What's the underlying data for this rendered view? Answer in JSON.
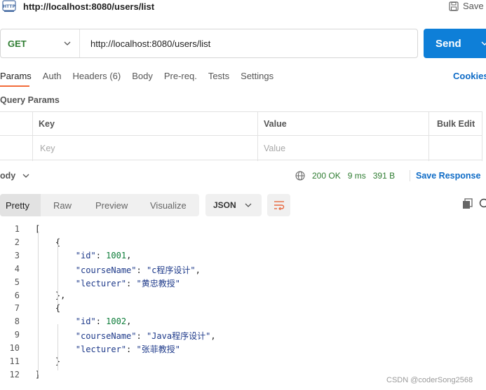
{
  "header": {
    "url": "http://localhost:8080/users/list",
    "save_label": "Save"
  },
  "request": {
    "method": "GET",
    "url": "http://localhost:8080/users/list",
    "send_label": "Send"
  },
  "request_tabs": [
    "Params",
    "Auth",
    "Headers",
    "Body",
    "Pre-req.",
    "Tests",
    "Settings"
  ],
  "headers_count": "(6)",
  "cookies_label": "Cookies",
  "query_params": {
    "title": "Query Params",
    "col_key": "Key",
    "col_value": "Value",
    "bulk_edit": "Bulk Edit",
    "key_placeholder": "Key",
    "value_placeholder": "Value"
  },
  "response": {
    "body_label": "ody",
    "status": "200 OK",
    "time": "9 ms",
    "size": "391 B",
    "save_response": "Save Response",
    "view_tabs": [
      "Pretty",
      "Raw",
      "Preview",
      "Visualize"
    ],
    "format": "JSON"
  },
  "code_lines": [
    {
      "n": "1",
      "text": "["
    },
    {
      "n": "2",
      "text": "    {"
    },
    {
      "n": "3",
      "text": "        \"id\": 1001,"
    },
    {
      "n": "4",
      "text": "        \"courseName\": \"c程序设计\","
    },
    {
      "n": "5",
      "text": "        \"lecturer\": \"黄忠教授\""
    },
    {
      "n": "6",
      "text": "    },"
    },
    {
      "n": "7",
      "text": "    {"
    },
    {
      "n": "8",
      "text": "        \"id\": 1002,"
    },
    {
      "n": "9",
      "text": "        \"courseName\": \"Java程序设计\","
    },
    {
      "n": "10",
      "text": "        \"lecturer\": \"张菲教授\""
    },
    {
      "n": "11",
      "text": "    }"
    },
    {
      "n": "12",
      "text": "]"
    }
  ],
  "watermark": "CSDN @coderSong2568",
  "colors": {
    "accent": "#0e7fd8",
    "method_get": "#2f7d32",
    "active_tab": "#f26b3a",
    "link": "#0e6bc6"
  }
}
